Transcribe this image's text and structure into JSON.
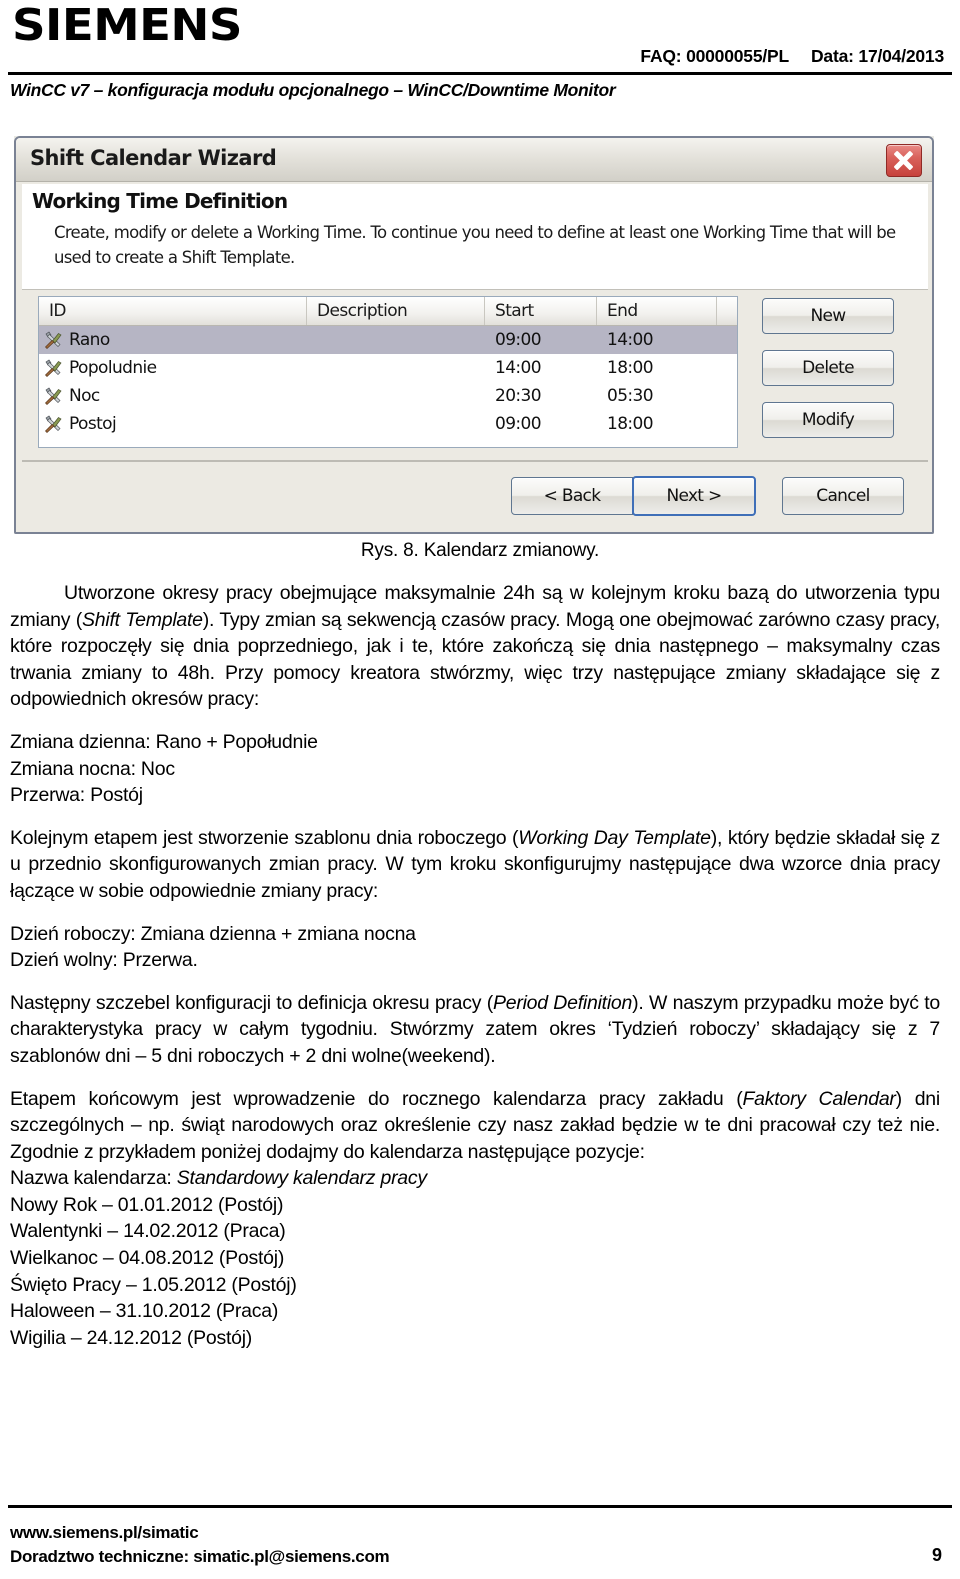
{
  "header": {
    "logo": "SIEMENS",
    "faq": "FAQ: 00000055/PL",
    "date": "Data: 17/04/2013",
    "subtitle": "WinCC v7 – konfiguracja modułu opcjonalnego – WinCC/Downtime Monitor"
  },
  "dialog": {
    "title": "Shift Calendar Wizard",
    "close_icon": "close-icon",
    "heading": "Working Time Definition",
    "description": "Create, modify or delete a Working Time. To continue you need to define at least one Working Time that will be used to create a Shift Template.",
    "table": {
      "columns": [
        "ID",
        "Description",
        "Start",
        "End"
      ],
      "rows": [
        {
          "id": "Rano",
          "description": "",
          "start": "09:00",
          "end": "14:00",
          "selected": true
        },
        {
          "id": "Popoludnie",
          "description": "",
          "start": "14:00",
          "end": "18:00",
          "selected": false
        },
        {
          "id": "Noc",
          "description": "",
          "start": "20:30",
          "end": "05:30",
          "selected": false
        },
        {
          "id": "Postoj",
          "description": "",
          "start": "09:00",
          "end": "18:00",
          "selected": false
        }
      ]
    },
    "side_buttons": {
      "new": "New",
      "delete": "Delete",
      "modify": "Modify"
    },
    "nav_buttons": {
      "back": "< Back",
      "next": "Next >",
      "cancel": "Cancel"
    }
  },
  "caption": "Rys. 8. Kalendarz zmianowy.",
  "body": {
    "p1_a": "Utworzone okresy pracy obejmujące maksymalnie 24h są w kolejnym kroku bazą do utworzenia typu zmiany (",
    "p1_i1": "Shift Template",
    "p1_b": "). Typy zmian są sekwencją czasów pracy. Mogą one obejmować zarówno czasy pracy, które rozpoczęły się dnia poprzedniego, jak i te, które zakończą się dnia następnego – maksymalny czas trwania zmiany to 48h. Przy pomocy kreatora stwórzmy, więc trzy następujące zmiany składające się z odpowiednich okresów pracy:",
    "p1_l1": "Zmiana dzienna: Rano + Popołudnie",
    "p1_l2": "Zmiana nocna: Noc",
    "p1_l3": "Przerwa: Postój",
    "p2_a": "Kolejnym etapem jest stworzenie szablonu dnia roboczego (",
    "p2_i1": "Working Day Template",
    "p2_b": "), który będzie składał się z u przednio skonfigurowanych zmian pracy. W tym kroku skonfigurujmy następujące dwa wzorce dnia pracy łączące w sobie odpowiednie zmiany pracy:",
    "p2_l1": "Dzień roboczy: Zmiana dzienna + zmiana nocna",
    "p2_l2": "Dzień wolny: Przerwa.",
    "p3_a": "Następny szczebel konfiguracji to definicja okresu pracy (",
    "p3_i1": "Period Definition",
    "p3_b": "). W naszym przypadku może być to charakterystyka pracy w całym tygodniu. Stwórzmy zatem okres ‘Tydzień roboczy’ składający się z 7 szablonów dni – 5 dni roboczych + 2 dni wolne(weekend).",
    "p4_a": "Etapem końcowym jest wprowadzenie do rocznego kalendarza pracy zakładu (",
    "p4_i1": "Faktory Calendar",
    "p4_b": ") dni szczególnych – np. świąt narodowych oraz określenie czy nasz zakład będzie w te dni pracował czy też nie. Zgodnie z przykładem poniżej dodajmy do kalendarza następujące pozycje:",
    "p4_l0_label": "Nazwa kalendarza: ",
    "p4_l0_value": "Standardowy kalendarz pracy",
    "holidays": [
      "Nowy Rok – 01.01.2012 (Postój)",
      "Walentynki – 14.02.2012 (Praca)",
      "Wielkanoc – 04.08.2012 (Postój)",
      "Święto Pracy – 1.05.2012 (Postój)",
      "Haloween – 31.10.2012 (Praca)",
      "Wigilia – 24.12.2012 (Postój)"
    ]
  },
  "footer": {
    "line1": "www.siemens.pl/simatic",
    "line2": "Doradztwo techniczne: simatic.pl@siemens.com",
    "page": "9"
  }
}
